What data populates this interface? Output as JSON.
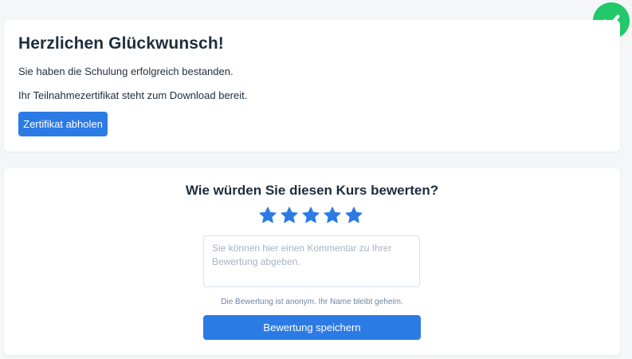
{
  "success": {
    "title": "Herzlichen Glückwunsch!",
    "passed_text": "Sie haben die Schulung erfolgreich bestanden.",
    "certificate_text": "Ihr Teilnahmezertifikat steht zum Download bereit.",
    "certificate_button": "Zertifikat abholen",
    "status_icon": "check-circle-icon"
  },
  "rating": {
    "question": "Wie würden Sie diesen Kurs bewerten?",
    "stars_selected": 5,
    "stars_total": 5,
    "comment_placeholder": "Sie können hier einen Kommentar zu Ihrer Bewertung abgeben.",
    "comment_value": "",
    "hint": "Die Bewertung ist anonym. Ihr Name bleibt geheim.",
    "save_button": "Bewertung speichern"
  },
  "colors": {
    "primary": "#2c7be5",
    "success": "#22c86a",
    "star": "#2c7be5",
    "background": "#f5f6f8",
    "card": "#ffffff",
    "text": "#1f2d3d"
  }
}
